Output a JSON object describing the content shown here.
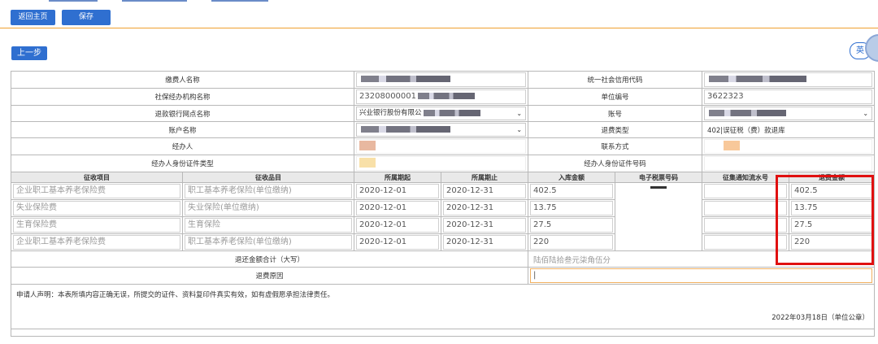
{
  "toolbar": {
    "home": "返回主页",
    "save": "保存"
  },
  "prev_label": "上一步",
  "lang_label": "英",
  "form": {
    "payer_name_label": "缴费人名称",
    "credit_code_label": "统一社会信用代码",
    "agency_label": "社保经办机构名称",
    "agency_value_prefix": "23208000001",
    "unit_no_label": "单位编号",
    "unit_no_value": "3622323",
    "bank_label": "退款银行网点名称",
    "bank_value_prefix": "兴业银行股份有限公",
    "account_no_label": "账号",
    "account_name_label": "账户名称",
    "refund_type_label": "退费类型",
    "refund_type_value": "402|误征税（费）款退库",
    "agent_label": "经办人",
    "contact_label": "联系方式",
    "agent_id_type_label": "经办人身份证件类型",
    "agent_id_no_label": "经办人身份证件号码"
  },
  "table": {
    "headers": [
      "征收项目",
      "征收品目",
      "所属期起",
      "所属期止",
      "入库金额",
      "电子税票号码",
      "征集通知流水号",
      "退费金额"
    ],
    "rows": [
      {
        "item": "企业职工基本养老保险费",
        "sub": "职工基本养老保险(单位缴纳)",
        "start": "2020-12-01",
        "end": "2020-12-31",
        "amount": "402.5",
        "refund": "402.5"
      },
      {
        "item": "失业保险费",
        "sub": "失业保险(单位缴纳)",
        "start": "2020-12-01",
        "end": "2020-12-31",
        "amount": "13.75",
        "refund": "13.75"
      },
      {
        "item": "生育保险费",
        "sub": "生育保险",
        "start": "2020-12-01",
        "end": "2020-12-31",
        "amount": "27.5",
        "refund": "27.5"
      },
      {
        "item": "企业职工基本养老保险费",
        "sub": "职工基本养老保险(单位缴纳)",
        "start": "2020-12-01",
        "end": "2020-12-31",
        "amount": "220",
        "refund": "220"
      }
    ]
  },
  "total_label": "退还金额合计（大写）",
  "total_value": "陆佰陆拾叁元柒角伍分",
  "reason_label": "退费原因",
  "declaration": "申请人声明：本表所填内容正确无误，所提交的证件、资料复印件真实有效，如有虚假愿承担法律责任。",
  "date_stamp": "2022年03月18日（单位公章）",
  "colors": {
    "accent": "#2f6fd0",
    "highlight": "#e01010",
    "divider": "#f0a030"
  }
}
